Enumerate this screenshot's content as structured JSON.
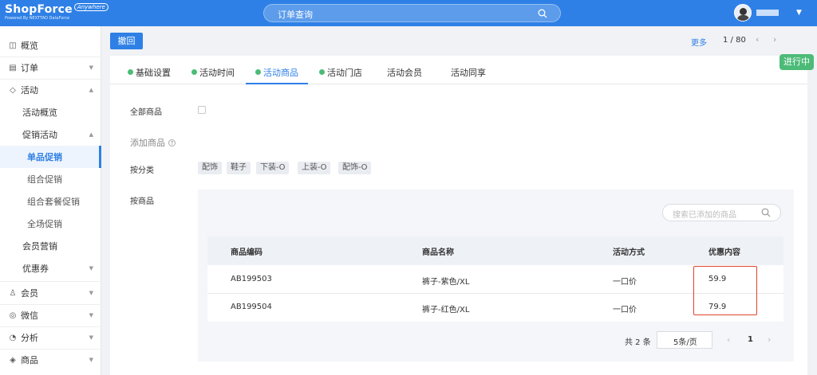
{
  "header": {
    "brand": "ShopForce",
    "brand_badge": "Anywhere",
    "brand_sub": "Powered By NEXTTAO DataForce",
    "search_placeholder": "订单查询"
  },
  "sidebar": {
    "items": [
      {
        "label": "概览",
        "icon": "dashboard-icon"
      },
      {
        "label": "订单",
        "icon": "document-icon"
      },
      {
        "label": "活动",
        "icon": "tag-icon"
      },
      {
        "label": "活动概览"
      },
      {
        "label": "促销活动"
      },
      {
        "label": "单品促销"
      },
      {
        "label": "组合促销"
      },
      {
        "label": "组合套餐促销"
      },
      {
        "label": "全场促销"
      },
      {
        "label": "会员营销"
      },
      {
        "label": "优惠券"
      },
      {
        "label": "会员",
        "icon": "user-icon"
      },
      {
        "label": "微信",
        "icon": "wechat-icon"
      },
      {
        "label": "分析",
        "icon": "pie-chart-icon"
      },
      {
        "label": "商品",
        "icon": "box-icon"
      }
    ],
    "active": "单品促销"
  },
  "toolbar": {
    "back_label": "撤回",
    "more_label": "更多",
    "page_indicator": "1 / 80",
    "status": "进行中"
  },
  "tabs": [
    {
      "label": "基础设置",
      "done": true
    },
    {
      "label": "活动时间",
      "done": true
    },
    {
      "label": "活动商品",
      "done": true
    },
    {
      "label": "活动门店",
      "done": true
    },
    {
      "label": "活动会员",
      "done": false
    },
    {
      "label": "活动同享",
      "done": false
    }
  ],
  "active_tab": "活动商品",
  "form": {
    "all_products_label": "全部商品",
    "add_products_title": "添加商品",
    "by_category_label": "按分类",
    "categories": [
      "配饰",
      "鞋子",
      "下装-O",
      "上装-O",
      "配饰-O"
    ],
    "by_product_label": "按商品",
    "product_search_placeholder": "搜索已添加的商品"
  },
  "table": {
    "columns": [
      "商品编码",
      "商品名称",
      "活动方式",
      "优惠内容"
    ],
    "rows": [
      {
        "code": "AB199503",
        "name": "裤子-紫色/XL",
        "method": "一口价",
        "discount": "59.9"
      },
      {
        "code": "AB199504",
        "name": "裤子-红色/XL",
        "method": "一口价",
        "discount": "79.9"
      }
    ]
  },
  "pagination": {
    "total": "共 2 条",
    "page_size": "5条/页",
    "current_page": "1"
  },
  "colors": {
    "primary": "#2f80e6",
    "success": "#4cbb78",
    "highlight": "#e0432e"
  }
}
